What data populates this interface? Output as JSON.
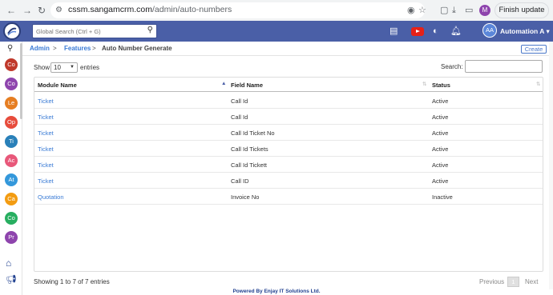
{
  "browser": {
    "url_host": "cssm.sangamcrm.com",
    "url_path": "/admin/auto-numbers",
    "profile_initial": "M",
    "finish_update_label": "Finish update"
  },
  "header": {
    "search_placeholder": "Global Search (Ctrl + G)",
    "user_initials": "AA",
    "user_name": "Automation A",
    "user_caret": "▾"
  },
  "sidebar": {
    "items": [
      {
        "label": "Co",
        "color": "#c0392b"
      },
      {
        "label": "Co",
        "color": "#8e44ad"
      },
      {
        "label": "Le",
        "color": "#e67e22"
      },
      {
        "label": "Op",
        "color": "#e74c3c"
      },
      {
        "label": "Ti",
        "color": "#2980b9"
      },
      {
        "label": "Ac",
        "color": "#e8587a"
      },
      {
        "label": "At",
        "color": "#3498db"
      },
      {
        "label": "Ca",
        "color": "#f39c12"
      },
      {
        "label": "Co",
        "color": "#27ae60"
      },
      {
        "label": "Pr",
        "color": "#8e44ad"
      }
    ]
  },
  "breadcrumb": {
    "admin": "Admin",
    "features": "Features",
    "current": "Auto Number Generate",
    "separator": ">"
  },
  "create_label": "Create",
  "controls": {
    "show_label": "Show",
    "entries_value": "10",
    "entries_label": "entries",
    "search_label": "Search:"
  },
  "table": {
    "columns": [
      "Module Name",
      "Field Name",
      "Status"
    ],
    "rows": [
      [
        "Ticket",
        "Call Id",
        "Active"
      ],
      [
        "Ticket",
        "Call Id",
        "Active"
      ],
      [
        "Ticket",
        "Call Id Ticket No",
        "Active"
      ],
      [
        "Ticket",
        "Call Id Tickets",
        "Active"
      ],
      [
        "Ticket",
        "Call Id Tickett",
        "Active"
      ],
      [
        "Ticket",
        "Call ID",
        "Active"
      ],
      [
        "Quotation",
        "Invoice No",
        "Inactive"
      ]
    ]
  },
  "footer": {
    "info": "Showing 1 to 7 of 7 entries",
    "previous": "Previous",
    "page": "1",
    "next": "Next",
    "powered": "Powered By Enjay IT Solutions Ltd."
  }
}
